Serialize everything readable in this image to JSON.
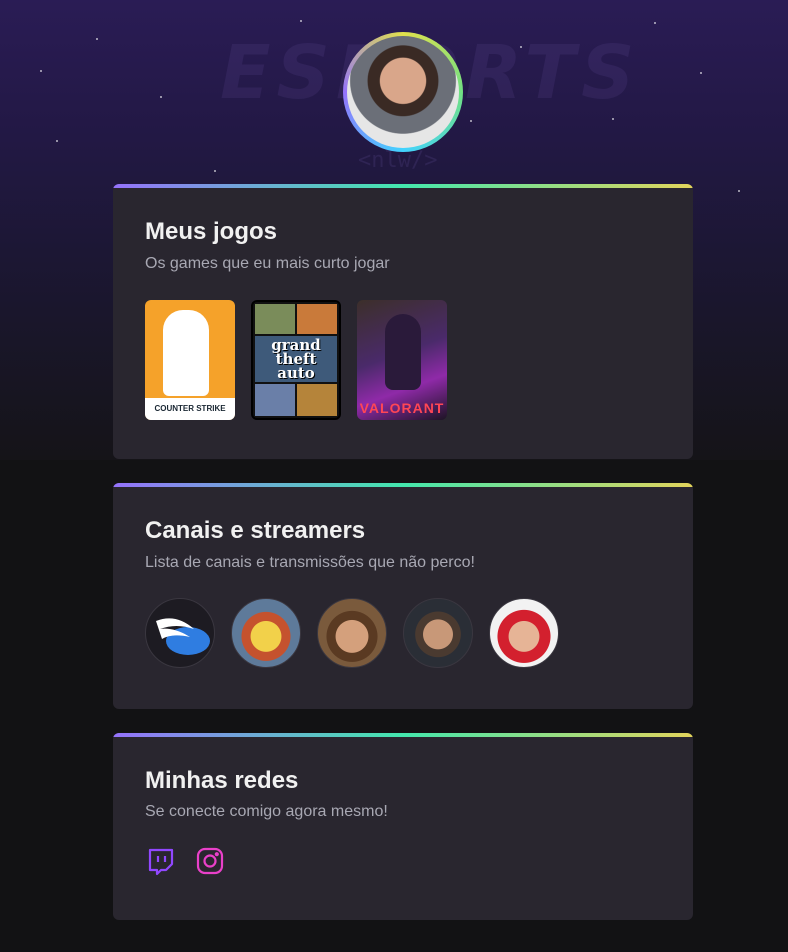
{
  "games_card": {
    "title": "Meus jogos",
    "subtitle": "Os games que eu mais curto jogar",
    "games": [
      {
        "name": "Counter Strike",
        "label": "COUNTER STRIKE"
      },
      {
        "name": "Grand Theft Auto V",
        "label": "grand theft auto"
      },
      {
        "name": "Valorant",
        "label": "VALORANT"
      }
    ]
  },
  "streamers_card": {
    "title": "Canais e streamers",
    "subtitle": "Lista de canais e transmissões que não perco!"
  },
  "social_card": {
    "title": "Minhas redes",
    "subtitle": "Se conecte comigo agora mesmo!",
    "links": [
      {
        "name": "twitch",
        "icon": "twitch-icon",
        "color": "#9147ff"
      },
      {
        "name": "instagram",
        "icon": "instagram-icon",
        "color": "#e940c9"
      }
    ]
  },
  "colors": {
    "background": "#121214",
    "card": "#29262f",
    "title": "#f1f1f1",
    "subtitle": "#a8a8b3",
    "gradient": [
      "#9572fc",
      "#43e7ad",
      "#e2d45c"
    ]
  }
}
